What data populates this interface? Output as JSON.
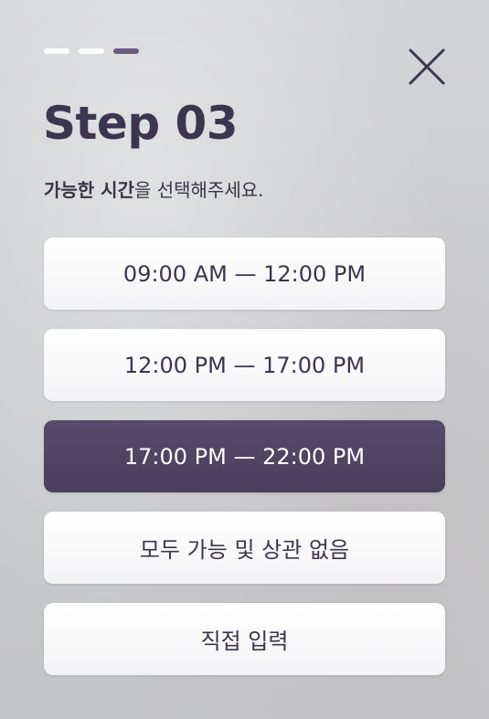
{
  "step": {
    "segments": [
      {
        "state": "done"
      },
      {
        "state": "done"
      },
      {
        "state": "current"
      }
    ],
    "title": "Step 03",
    "subtitle_bold": "가능한 시간",
    "subtitle_rest": "을 선택해주세요."
  },
  "close_icon": "close-icon",
  "options": [
    {
      "label": "09:00 AM — 12:00 PM",
      "selected": false
    },
    {
      "label": "12:00 PM — 17:00 PM",
      "selected": false
    },
    {
      "label": "17:00 PM — 22:00 PM",
      "selected": true
    },
    {
      "label": "모두 가능 및 상관 없음",
      "selected": false
    },
    {
      "label": "직접 입력",
      "selected": false
    }
  ],
  "colors": {
    "accent": "#4a3f5c",
    "text": "#3d3550",
    "progress_active": "#6a5a80",
    "progress_inactive": "#ffffff"
  }
}
